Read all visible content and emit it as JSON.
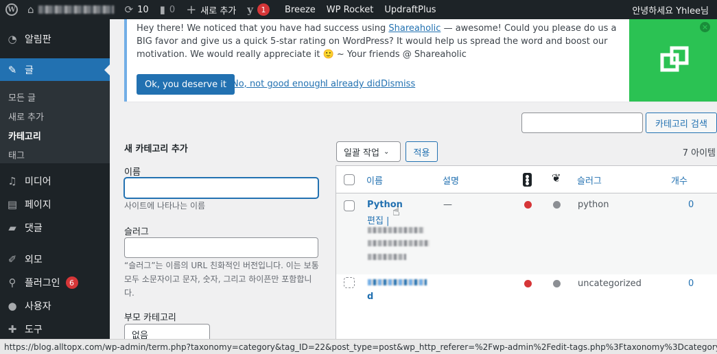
{
  "admin_bar": {
    "updates_count": "10",
    "comments_count": "0",
    "new_label": "새로 추가",
    "yoast_count": "1",
    "items": [
      "Breeze",
      "WP Rocket",
      "UpdraftPlus"
    ],
    "greeting": "안녕하세요 Yhlee님"
  },
  "sidebar": {
    "items": [
      {
        "label": "알림판",
        "icon": "dashboard-icon"
      },
      {
        "label": "글",
        "icon": "pin-icon"
      },
      {
        "label": "미디어",
        "icon": "media-icon"
      },
      {
        "label": "페이지",
        "icon": "page-icon"
      },
      {
        "label": "댓글",
        "icon": "comment-icon"
      },
      {
        "label": "외모",
        "icon": "brush-icon"
      },
      {
        "label": "플러그인",
        "icon": "plugin-icon",
        "badge": "6"
      },
      {
        "label": "사용자",
        "icon": "user-icon"
      },
      {
        "label": "도구",
        "icon": "wrench-icon"
      }
    ],
    "submenu": [
      "모든 글",
      "새로 추가",
      "카테고리",
      "태그"
    ]
  },
  "notice": {
    "line1_before": "Hey there! We noticed that you have had success using ",
    "line1_link": "Shareaholic",
    "line1_after": " — awesome! Could you please do us a BIG favor and give us a quick 5-star rating on WordPress? It would help us spread the word and boost our motivation. We would really appreciate it 🙂 ~ Your friends @ Shareaholic",
    "button": "Ok, you deserve it",
    "links": [
      "No, not good enough",
      "I already did",
      "Dismiss"
    ],
    "close": "×"
  },
  "search": {
    "button": "카테고리 검색"
  },
  "form": {
    "title": "새 카테고리 추가",
    "name_label": "이름",
    "name_help": "사이트에 나타나는 이름",
    "slug_label": "슬러그",
    "slug_help": "“슬러그”는 이름의 URL 친화적인 버전입니다. 이는 보통 모두 소문자이고 문자, 숫자, 그리고 하이픈만 포함합니다.",
    "parent_label": "부모 카테고리",
    "parent_value": "없음"
  },
  "table": {
    "bulk_action": "일괄 작업",
    "apply": "적용",
    "items_count": "7 아이템",
    "headers": {
      "name": "이름",
      "description": "설명",
      "slug": "슬러그",
      "count": "개수"
    },
    "rows": [
      {
        "name": "Python",
        "action": "편집 |",
        "description": "—",
        "slug": "python",
        "count": "0",
        "dot1": "#d63638",
        "dot2": "#8c8f94"
      },
      {
        "name_tail": "d",
        "slug": "uncategorized",
        "count": "0",
        "dot1": "#d63638",
        "dot2": "#8c8f94"
      }
    ]
  },
  "status_url": "https://blog.alltopx.com/wp-admin/term.php?taxonomy=category&tag_ID=22&post_type=post&wp_http_referer=%2Fwp-admin%2Fedit-tags.php%3Ftaxonomy%3Dcategory"
}
